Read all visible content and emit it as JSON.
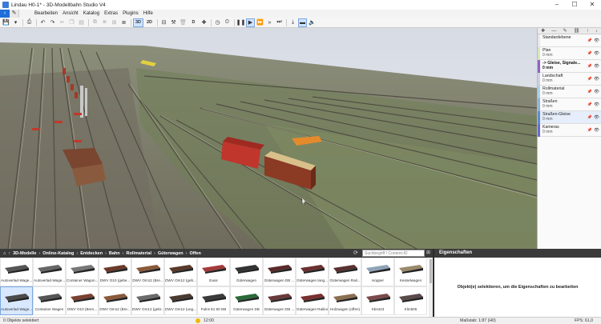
{
  "window": {
    "title": "Lindau H0-1* - 3D-Modellbahn Studio V4",
    "minimize": "–",
    "maximize": "☐",
    "close": "✕"
  },
  "nav": {
    "back": "‹",
    "edit": "✎"
  },
  "menu": [
    "Bearbeiten",
    "Ansicht",
    "Katalog",
    "Extras",
    "Plugins",
    "Hilfe"
  ],
  "toolbar": {
    "view_3d": "3D",
    "view_2d": "2D",
    "d_label": "D"
  },
  "layers": [
    {
      "name": "Standardebene",
      "value": "",
      "color": "#e8e8e8",
      "active": false
    },
    {
      "name": "Plan",
      "value": "0 mm",
      "color": "#d7e7c2",
      "active": false
    },
    {
      "name": "-> Gleise, Signale...",
      "value": "0 mm",
      "color": "#8e63c4",
      "active": true
    },
    {
      "name": "Landschaft",
      "value": "0 mm",
      "color": "#cfcfe8",
      "active": false
    },
    {
      "name": "Rollmaterial",
      "value": "0 mm",
      "color": "#a8d3e6",
      "active": false
    },
    {
      "name": "Straßen",
      "value": "0 mm",
      "color": "#8fb5d9",
      "active": false
    },
    {
      "name": "Straßen-Gleise",
      "value": "0 mm",
      "color": "#5c8fcf",
      "active": false
    },
    {
      "name": "Kameras",
      "value": "0 mm",
      "color": "#6b6bd0",
      "active": false
    }
  ],
  "catalog": {
    "breadcrumb": [
      "3D-Modelle",
      "Online-Katalog",
      "Entdecken",
      "Bahn",
      "Rollmaterial",
      "Güterwagen",
      "Offen"
    ],
    "search_placeholder": "Suchbegriff / Content-ID",
    "items": [
      {
        "label": "Autoverlad-Wage...",
        "color": "#555555",
        "sel": false
      },
      {
        "label": "Autoverlad-Wage...",
        "color": "#666666",
        "sel": false
      },
      {
        "label": "Container Wagon...",
        "color": "#777777",
        "sel": false
      },
      {
        "label": "DWV O10 (gebe...",
        "color": "#6b3a2a",
        "sel": false
      },
      {
        "label": "DWV Om12 (Bre...",
        "color": "#8a5a3a",
        "sel": false
      },
      {
        "label": "DWV Om12 (geb...",
        "color": "#5a3a2a",
        "sel": false
      },
      {
        "label": "Eaos",
        "color": "#a33a3a",
        "sel": false
      },
      {
        "label": "Güterwagen",
        "color": "#333333",
        "sel": false
      },
      {
        "label": "Güterwagen DB ...",
        "color": "#5a2a2a",
        "sel": false
      },
      {
        "label": "Güterwagen lang...",
        "color": "#6a3030",
        "sel": false
      },
      {
        "label": "Güterwagen Rail...",
        "color": "#5a3030",
        "sel": false
      },
      {
        "label": "Hopper",
        "color": "#8fa3b8",
        "sel": false
      },
      {
        "label": "Kesselwagen",
        "color": "#9a8a6a",
        "sel": false
      },
      {
        "label": "Autoverlad-Wage...",
        "color": "#4a4a4a",
        "sel": true
      },
      {
        "label": "Container Wagen",
        "color": "#555555",
        "sel": false
      },
      {
        "label": "DWV O10 (Bren...",
        "color": "#7a4030",
        "sel": false
      },
      {
        "label": "DWV Om12 (Bre...",
        "color": "#8a5a3a",
        "sel": false
      },
      {
        "label": "DWV Om12 (gebr...",
        "color": "#6a6a6a",
        "sel": false
      },
      {
        "label": "DWV Om12 (ung...",
        "color": "#4a3a30",
        "sel": false
      },
      {
        "label": "Falns 81 80 DB",
        "color": "#3a3a3a",
        "sel": false
      },
      {
        "label": "Güterwagen DB",
        "color": "#2a6a3a",
        "sel": false
      },
      {
        "label": "Güterwagen DB ...",
        "color": "#6a3a3a",
        "sel": false
      },
      {
        "label": "Güterwagen Railion",
        "color": "#7a3030",
        "sel": false
      },
      {
        "label": "Holzwagen (offen)",
        "color": "#8a7050",
        "sel": false
      },
      {
        "label": "Kbs443",
        "color": "#7a4a4a",
        "sel": false
      },
      {
        "label": "Klm505",
        "color": "#5a4a4a",
        "sel": false
      }
    ]
  },
  "properties": {
    "title": "Eigenschaften",
    "message": "Objekt(e) selektieren, um die Eigenschaften zu bearbeiten"
  },
  "status": {
    "selection": "0 Objekte selektiert",
    "time": "12:00",
    "scale": "Maßstab: 1:87 (H0)",
    "fps": "FPS: 61,0"
  }
}
